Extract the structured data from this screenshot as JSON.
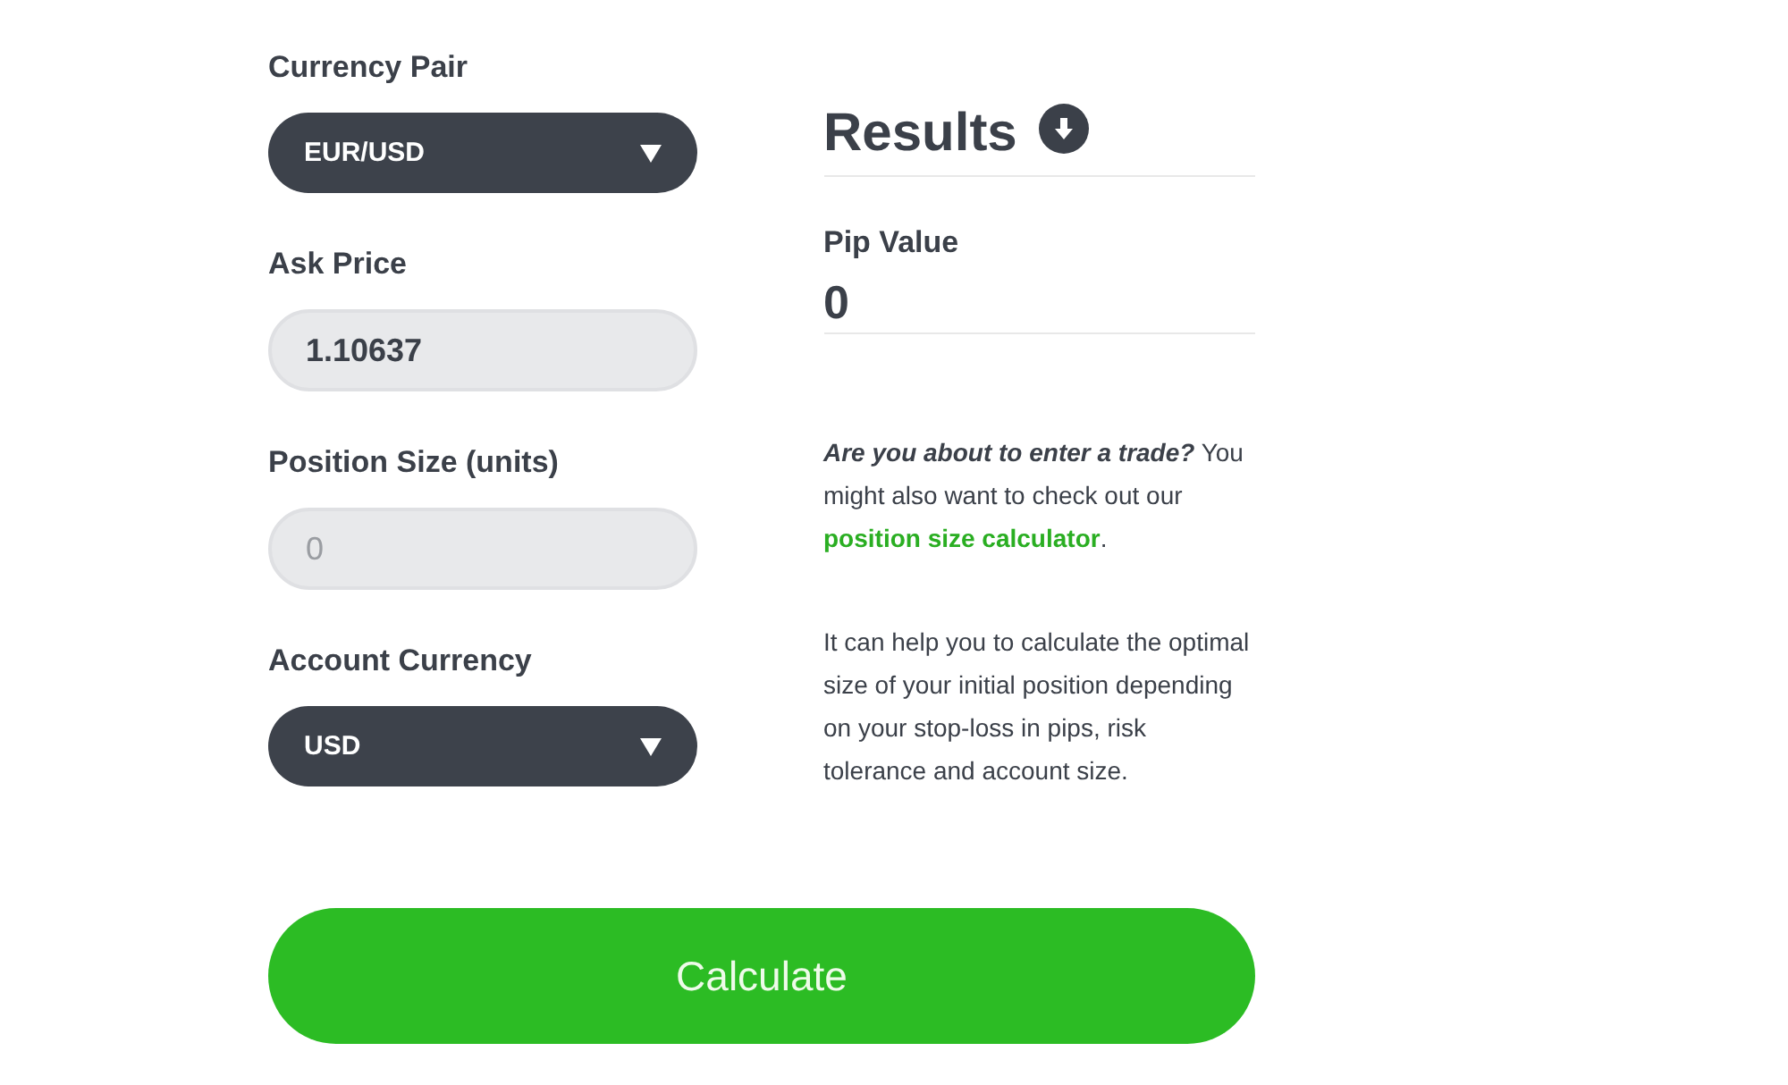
{
  "form": {
    "fields": [
      {
        "kind": "select",
        "label": "Currency Pair",
        "value": "EUR/USD"
      },
      {
        "kind": "input",
        "label": "Ask Price",
        "value": "1.10637"
      },
      {
        "kind": "input",
        "label": "Position Size (units)",
        "placeholder": "0"
      },
      {
        "kind": "select",
        "label": "Account Currency",
        "value": "USD"
      }
    ]
  },
  "results": {
    "title": "Results",
    "pip_value": {
      "label": "Pip Value",
      "value": "0"
    },
    "promo": {
      "text": "**Are you about to enter a trade?** You might also want to check out our",
      "link": "position size calculator",
      "after": "."
    },
    "description": "It can help you to calculate the optimal size of your initial position depending on your stop-loss in pips, risk tolerance and account size."
  },
  "calculate_button": {
    "label": "Calculate"
  }
}
